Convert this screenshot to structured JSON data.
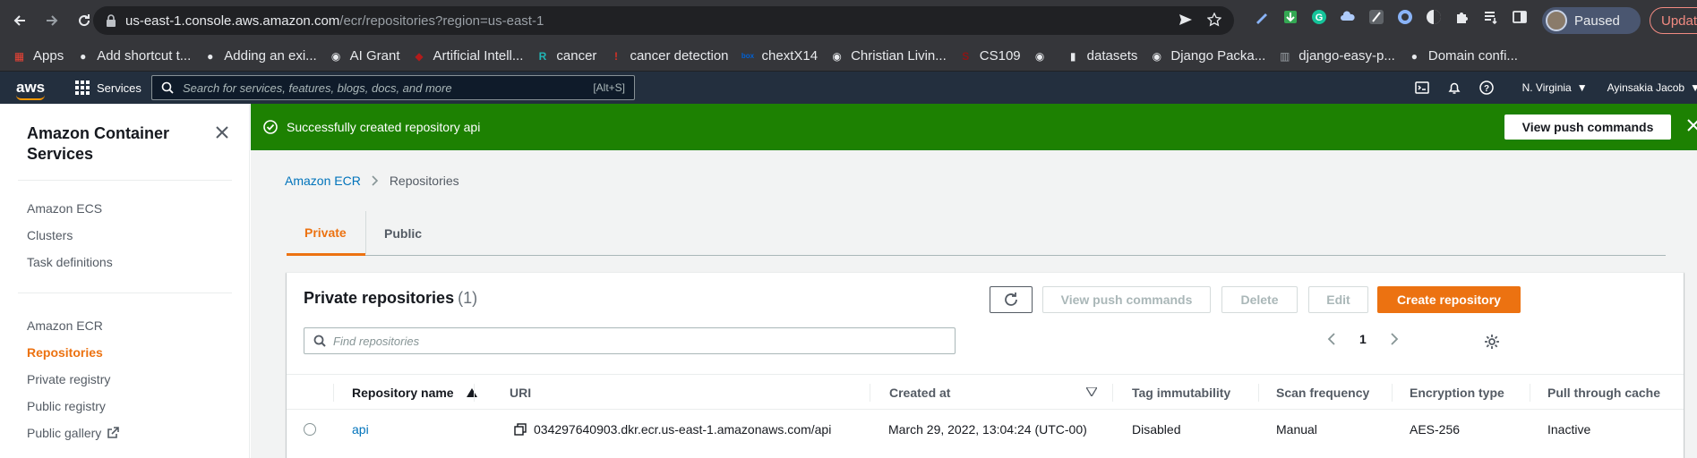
{
  "browser": {
    "url_host": "us-east-1.console.aws.amazon.com",
    "url_path": "/ecr/repositories?region=us-east-1",
    "profile_status": "Paused",
    "update_label": "Update"
  },
  "bookmarks": [
    {
      "label": "Apps",
      "icon": "apps-grid-icon",
      "color": "#ea4335"
    },
    {
      "label": "Add shortcut t...",
      "icon": "github-icon",
      "color": "#e8eaed"
    },
    {
      "label": "Adding an exi...",
      "icon": "github-icon",
      "color": "#e8eaed"
    },
    {
      "label": "AI Grant",
      "icon": "globe-icon",
      "color": "#e8eaed"
    },
    {
      "label": "Artificial Intell...",
      "icon": "shield-icon",
      "color": "#b31b1b"
    },
    {
      "label": "cancer",
      "icon": "r-icon",
      "color": "#21b6b6"
    },
    {
      "label": "cancer detection",
      "icon": "pin-icon",
      "color": "#d93025"
    },
    {
      "label": "chextX14",
      "icon": "box-icon",
      "color": "#0061d5"
    },
    {
      "label": "Christian Livin...",
      "icon": "globe-icon",
      "color": "#e8eaed"
    },
    {
      "label": "CS109",
      "icon": "stanford-icon",
      "color": "#8c1515"
    },
    {
      "label": "",
      "icon": "globe-icon",
      "color": "#e8eaed"
    },
    {
      "label": "datasets",
      "icon": "kaggle-icon",
      "color": "#e8eaed"
    },
    {
      "label": "Django Packa...",
      "icon": "globe-icon",
      "color": "#e8eaed"
    },
    {
      "label": "django-easy-p...",
      "icon": "building-icon",
      "color": "#9aa0a6"
    },
    {
      "label": "Domain confi...",
      "icon": "github-icon",
      "color": "#e8eaed"
    }
  ],
  "aws": {
    "services_label": "Services",
    "search_placeholder": "Search for services, features, blogs, docs, and more",
    "search_shortcut": "[Alt+S]",
    "region": "N. Virginia",
    "user": "Ayinsakia Jacob"
  },
  "sidebar": {
    "title": "Amazon Container Services",
    "section1": [
      {
        "label": "Amazon ECS"
      },
      {
        "label": "Clusters"
      },
      {
        "label": "Task definitions"
      }
    ],
    "section2": [
      {
        "label": "Amazon ECR"
      },
      {
        "label": "Repositories",
        "active": true
      },
      {
        "label": "Private registry"
      },
      {
        "label": "Public registry"
      },
      {
        "label": "Public gallery"
      }
    ]
  },
  "flash": {
    "message": "Successfully created repository api",
    "button": "View push commands"
  },
  "breadcrumb": {
    "root": "Amazon ECR",
    "current": "Repositories"
  },
  "tabs": [
    {
      "label": "Private",
      "active": true
    },
    {
      "label": "Public",
      "active": false
    }
  ],
  "panel": {
    "title": "Private repositories",
    "count": "(1)",
    "buttons": {
      "view_push": "View push commands",
      "delete": "Delete",
      "edit": "Edit",
      "create": "Create repository"
    },
    "filter_placeholder": "Find repositories",
    "page": "1"
  },
  "table": {
    "columns": [
      "Repository name",
      "URI",
      "Created at",
      "Tag immutability",
      "Scan frequency",
      "Encryption type",
      "Pull through cache"
    ],
    "rows": [
      {
        "name": "api",
        "uri": "034297640903.dkr.ecr.us-east-1.amazonaws.com/api",
        "created_at": "March 29, 2022, 13:04:24 (UTC-00)",
        "tag_immutability": "Disabled",
        "scan_frequency": "Manual",
        "encryption": "AES-256",
        "pull_through_cache": "Inactive"
      }
    ]
  },
  "colors": {
    "aws_nav": "#232f3e",
    "accent": "#ec7211",
    "success": "#1d8102",
    "link": "#0073bb"
  }
}
